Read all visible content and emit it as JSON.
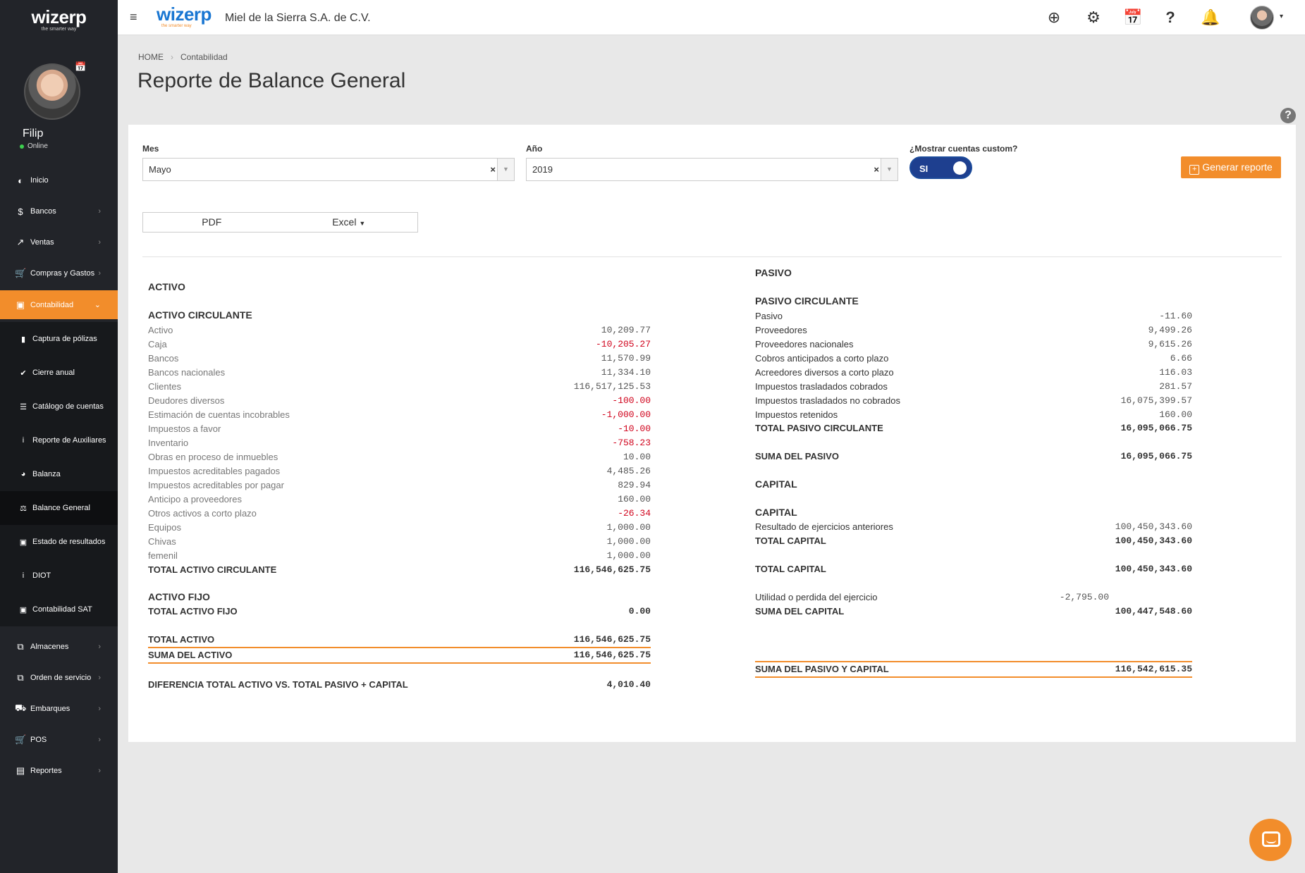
{
  "sidebar": {
    "brand": {
      "logo": "wizerp",
      "tagline": "the smarter way"
    },
    "user": {
      "name": "Filip",
      "status": "Online"
    },
    "items": [
      {
        "label": "Inicio",
        "icon": "dashboard-icon"
      },
      {
        "label": "Bancos",
        "icon": "dollar-icon"
      },
      {
        "label": "Ventas",
        "icon": "line-chart-icon"
      },
      {
        "label": "Compras y Gastos",
        "icon": "cart-icon"
      },
      {
        "label": "Contabilidad",
        "icon": "money-icon"
      },
      {
        "label": "Almacenes",
        "icon": "copy-icon"
      },
      {
        "label": "Orden de servicio",
        "icon": "copy-icon"
      },
      {
        "label": "Embarques",
        "icon": "truck-icon"
      },
      {
        "label": "POS",
        "icon": "cart-icon"
      },
      {
        "label": "Reportes",
        "icon": "list-icon"
      }
    ],
    "subitems": [
      {
        "label": "Captura de pólizas",
        "icon": "file-icon"
      },
      {
        "label": "Cierre anual",
        "icon": "check-circle-icon"
      },
      {
        "label": "Catálogo de cuentas",
        "icon": "list-icon"
      },
      {
        "label": "Reporte de Auxiliares",
        "icon": "info-icon"
      },
      {
        "label": "Balanza",
        "icon": "pie-chart-icon"
      },
      {
        "label": "Balance General",
        "icon": "scale-icon"
      },
      {
        "label": "Estado de resultados",
        "icon": "money-icon"
      },
      {
        "label": "DIOT",
        "icon": "info-icon"
      },
      {
        "label": "Contabilidad SAT",
        "icon": "money-icon"
      }
    ]
  },
  "topbar": {
    "logo": "wizerp",
    "logo_tagline": "the smarter way",
    "company": "Miel de la Sierra S.A. de C.V."
  },
  "breadcrumb": {
    "home": "HOME",
    "current": "Contabilidad"
  },
  "page_title": "Reporte de Balance General",
  "filters": {
    "month_label": "Mes",
    "month_value": "Mayo",
    "year_label": "Año",
    "year_value": "2019",
    "custom_label": "¿Mostrar cuentas custom?",
    "custom_value": "SI",
    "generate_label": "Generar reporte"
  },
  "export": {
    "pdf": "PDF",
    "excel": "Excel"
  },
  "activo": {
    "title": "ACTIVO",
    "circulante_title": "ACTIVO CIRCULANTE",
    "rows": [
      {
        "label": "Activo",
        "value": "10,209.77"
      },
      {
        "label": "Caja",
        "value": "-10,205.27"
      },
      {
        "label": "Bancos",
        "value": "11,570.99"
      },
      {
        "label": "Bancos nacionales",
        "value": "11,334.10"
      },
      {
        "label": "Clientes",
        "value": "116,517,125.53"
      },
      {
        "label": "Deudores diversos",
        "value": "-100.00"
      },
      {
        "label": "Estimación de cuentas incobrables",
        "value": "-1,000.00"
      },
      {
        "label": "Impuestos a favor",
        "value": "-10.00"
      },
      {
        "label": "Inventario",
        "value": "-758.23"
      },
      {
        "label": "Obras en proceso de inmuebles",
        "value": "10.00"
      },
      {
        "label": "Impuestos acreditables pagados",
        "value": "4,485.26"
      },
      {
        "label": "Impuestos acreditables por pagar",
        "value": "829.94"
      },
      {
        "label": "Anticipo a proveedores",
        "value": "160.00"
      },
      {
        "label": "Otros activos a corto plazo",
        "value": "-26.34"
      },
      {
        "label": "Equipos",
        "value": "1,000.00"
      },
      {
        "label": "Chivas",
        "value": "1,000.00"
      },
      {
        "label": "femenil",
        "value": "1,000.00"
      }
    ],
    "total_circulante_label": "TOTAL ACTIVO CIRCULANTE",
    "total_circulante_value": "116,546,625.75",
    "fijo_title": "ACTIVO FIJO",
    "total_fijo_label": "TOTAL ACTIVO FIJO",
    "total_fijo_value": "0.00",
    "total_label": "TOTAL ACTIVO",
    "total_value": "116,546,625.75",
    "suma_label": "SUMA DEL ACTIVO",
    "suma_value": "116,546,625.75",
    "diferencia_label": "DIFERENCIA TOTAL ACTIVO VS. TOTAL PASIVO + CAPITAL",
    "diferencia_value": "4,010.40"
  },
  "pasivo": {
    "title": "PASIVO",
    "circulante_title": "PASIVO CIRCULANTE",
    "rows": [
      {
        "label": "Pasivo",
        "value": "-11.60"
      },
      {
        "label": "Proveedores",
        "value": "9,499.26"
      },
      {
        "label": "Proveedores nacionales",
        "value": "9,615.26"
      },
      {
        "label": "Cobros anticipados a corto plazo",
        "value": "6.66"
      },
      {
        "label": "Acreedores diversos a corto plazo",
        "value": "116.03"
      },
      {
        "label": "Impuestos trasladados cobrados",
        "value": "281.57"
      },
      {
        "label": "Impuestos trasladados no cobrados",
        "value": "16,075,399.57"
      },
      {
        "label": "Impuestos retenidos",
        "value": "160.00"
      }
    ],
    "total_circulante_label": "TOTAL PASIVO CIRCULANTE",
    "total_circulante_value": "16,095,066.75",
    "suma_label": "SUMA DEL PASIVO",
    "suma_value": "16,095,066.75"
  },
  "capital": {
    "title": "CAPITAL",
    "sub_title": "CAPITAL",
    "row_label": "Resultado de ejercicios anteriores",
    "row_value": "100,450,343.60",
    "total_label": "TOTAL CAPITAL",
    "total_value": "100,450,343.60",
    "total2_label": "TOTAL CAPITAL",
    "total2_value": "100,450,343.60",
    "utilidad_label": "Utilidad o perdida del ejercicio",
    "utilidad_value": "-2,795.00",
    "suma_label": "SUMA DEL CAPITAL",
    "suma_value": "100,447,548.60",
    "suma_pc_label": "SUMA DEL PASIVO Y CAPITAL",
    "suma_pc_value": "116,542,615.35"
  },
  "colors": {
    "accent": "#f28d2b",
    "sidebar": "#222429",
    "negative": "#d0021b",
    "toggle": "#1e3f8f",
    "brand_blue": "#1976d2"
  }
}
